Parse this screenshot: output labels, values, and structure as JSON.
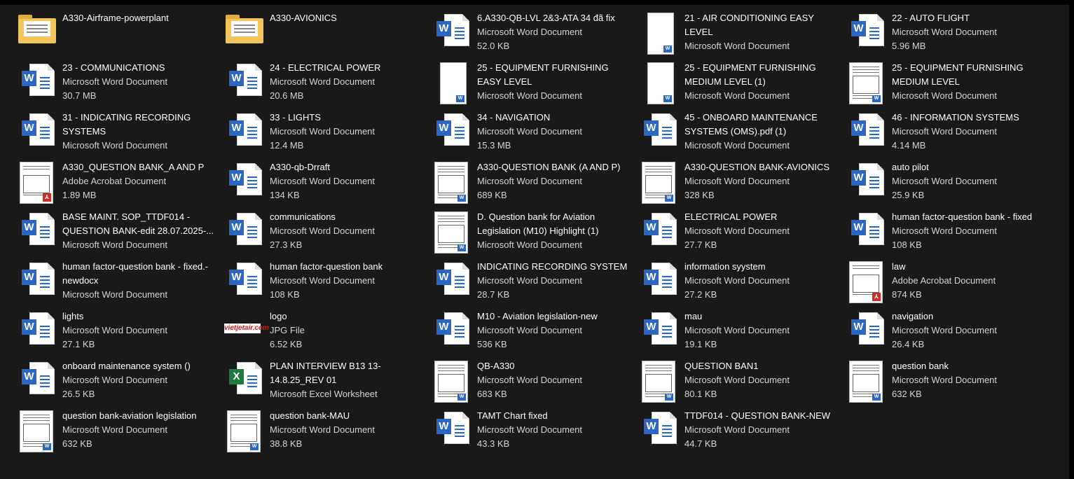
{
  "items": [
    {
      "name": "A330-Airframe-powerplant",
      "type": "",
      "size": "",
      "icon": "folder-icon"
    },
    {
      "name": "A330-AVIONICS",
      "type": "",
      "size": "",
      "icon": "folder-icon"
    },
    {
      "name": "6.A330-QB-LVL 2&3-ATA 34 đã fix",
      "type": "Microsoft Word Document",
      "size": "52.0 KB",
      "icon": "word-icon"
    },
    {
      "name": "21 - AIR CONDITIONING EASY LEVEL",
      "type": "Microsoft Word Document",
      "size": "",
      "icon": "word-thumb-blank"
    },
    {
      "name": "22 - AUTO FLIGHT",
      "type": "Microsoft Word Document",
      "size": "5.96 MB",
      "icon": "word-icon"
    },
    {
      "name": "23 - COMMUNICATIONS",
      "type": "Microsoft Word Document",
      "size": "30.7 MB",
      "icon": "word-icon"
    },
    {
      "name": "24 - ELECTRICAL POWER",
      "type": "Microsoft Word Document",
      "size": "20.6 MB",
      "icon": "word-icon"
    },
    {
      "name": "25 - EQUIPMENT  FURNISHING EASY LEVEL",
      "type": "Microsoft Word Document",
      "size": "",
      "icon": "word-thumb-blank"
    },
    {
      "name": "25 - EQUIPMENT  FURNISHING MEDIUM LEVEL (1)",
      "type": "Microsoft Word Document",
      "size": "",
      "icon": "word-thumb-blank"
    },
    {
      "name": "25 - EQUIPMENT  FURNISHING MEDIUM LEVEL",
      "type": "Microsoft Word Document",
      "size": "",
      "icon": "word-thumb"
    },
    {
      "name": "31 - INDICATING  RECORDING SYSTEMS",
      "type": "Microsoft Word Document",
      "size": "",
      "icon": "word-icon"
    },
    {
      "name": "33 - LIGHTS",
      "type": "Microsoft Word Document",
      "size": "12.4 MB",
      "icon": "word-icon"
    },
    {
      "name": "34 - NAVIGATION",
      "type": "Microsoft Word Document",
      "size": "15.3 MB",
      "icon": "word-icon"
    },
    {
      "name": "45 - ONBOARD MAINTENANCE SYSTEMS (OMS).pdf (1)",
      "type": "Microsoft Word Document",
      "size": "",
      "icon": "word-icon"
    },
    {
      "name": "46 - INFORMATION SYSTEMS",
      "type": "Microsoft Word Document",
      "size": "4.14 MB",
      "icon": "word-icon"
    },
    {
      "name": "A330_QUESTION BANK_A AND P",
      "type": "Adobe Acrobat Document",
      "size": "1.89 MB",
      "icon": "pdf-thumb"
    },
    {
      "name": "A330-qb-Drraft",
      "type": "Microsoft Word Document",
      "size": "134 KB",
      "icon": "word-icon"
    },
    {
      "name": "A330-QUESTION BANK (A AND P)",
      "type": "Microsoft Word Document",
      "size": "689 KB",
      "icon": "word-thumb"
    },
    {
      "name": "A330-QUESTION BANK-AVIONICS",
      "type": "Microsoft Word Document",
      "size": "328 KB",
      "icon": "word-thumb"
    },
    {
      "name": "auto pilot",
      "type": "Microsoft Word Document",
      "size": "25.9 KB",
      "icon": "word-icon"
    },
    {
      "name": "BASE MAINT. SOP_TTDF014 - QUESTION BANK-edit 28.07.2025-...",
      "type": "Microsoft Word Document",
      "size": "",
      "icon": "word-icon"
    },
    {
      "name": "communications",
      "type": "Microsoft Word Document",
      "size": "27.3 KB",
      "icon": "word-icon"
    },
    {
      "name": "D. Question bank for Aviation Legislation (M10) Highlight (1)",
      "type": "Microsoft Word Document",
      "size": "",
      "icon": "word-thumb"
    },
    {
      "name": "ELECTRICAL POWER",
      "type": "Microsoft Word Document",
      "size": "27.7 KB",
      "icon": "word-icon"
    },
    {
      "name": "human factor-question bank - fixed",
      "type": "Microsoft Word Document",
      "size": "108 KB",
      "icon": "word-icon"
    },
    {
      "name": "human factor-question bank - fixed.-newdocx",
      "type": "Microsoft Word Document",
      "size": "",
      "icon": "word-icon"
    },
    {
      "name": "human factor-question bank",
      "type": "Microsoft Word Document",
      "size": "108 KB",
      "icon": "word-icon"
    },
    {
      "name": "INDICATING RECORDING SYSTEM",
      "type": "Microsoft Word Document",
      "size": "28.7 KB",
      "icon": "word-icon"
    },
    {
      "name": "information syystem",
      "type": "Microsoft Word Document",
      "size": "27.2 KB",
      "icon": "word-icon"
    },
    {
      "name": "law",
      "type": "Adobe Acrobat Document",
      "size": "874 KB",
      "icon": "pdf-thumb"
    },
    {
      "name": "lights",
      "type": "Microsoft Word Document",
      "size": "27.1 KB",
      "icon": "word-icon"
    },
    {
      "name": "logo",
      "type": "JPG File",
      "size": "6.52 KB",
      "icon": "jpg-thumb"
    },
    {
      "name": "M10 - Aviation legislation-new",
      "type": "Microsoft Word Document",
      "size": "536 KB",
      "icon": "word-icon"
    },
    {
      "name": "mau",
      "type": "Microsoft Word Document",
      "size": "19.1 KB",
      "icon": "word-icon"
    },
    {
      "name": "navigation",
      "type": "Microsoft Word Document",
      "size": "26.4 KB",
      "icon": "word-icon"
    },
    {
      "name": "onboard maintenance system ()",
      "type": "Microsoft Word Document",
      "size": "26.5 KB",
      "icon": "word-icon"
    },
    {
      "name": "PLAN INTERVIEW B13 13-14.8.25_REV 01",
      "type": "Microsoft Excel Worksheet",
      "size": "",
      "icon": "excel-icon"
    },
    {
      "name": "QB-A330",
      "type": "Microsoft Word Document",
      "size": "683 KB",
      "icon": "word-thumb"
    },
    {
      "name": "QUESTION BAN1",
      "type": "Microsoft Word Document",
      "size": "80.1 KB",
      "icon": "word-thumb"
    },
    {
      "name": "question bank",
      "type": "Microsoft Word Document",
      "size": "632 KB",
      "icon": "word-thumb"
    },
    {
      "name": "question bank-aviation legislation",
      "type": "Microsoft Word Document",
      "size": "632 KB",
      "icon": "word-thumb"
    },
    {
      "name": "question bank-MAU",
      "type": "Microsoft Word Document",
      "size": "38.8 KB",
      "icon": "word-thumb"
    },
    {
      "name": "TAMT Chart fixed",
      "type": "Microsoft Word Document",
      "size": "43.3 KB",
      "icon": "word-icon"
    },
    {
      "name": "TTDF014 - QUESTION BANK-NEW",
      "type": "Microsoft Word Document",
      "size": "44.7 KB",
      "icon": "word-icon"
    }
  ],
  "colors": {
    "background": "#191919",
    "text": "#ffffff",
    "subtext": "#d4d4d4",
    "word_blue": "#2b66c3",
    "folder": "#f2c65c",
    "pdf_red": "#d32a2a",
    "excel_green": "#1f7a3e"
  },
  "badges": {
    "word": "W",
    "excel": "X",
    "pdf": "⅄",
    "jpg": "vietjetair.com"
  }
}
